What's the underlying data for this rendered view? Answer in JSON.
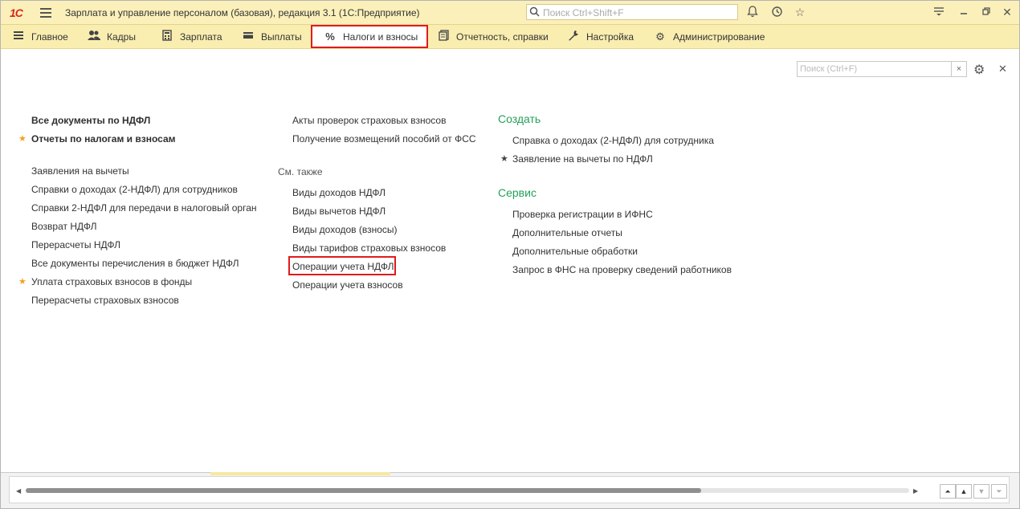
{
  "titlebar": {
    "logo": "1С",
    "title": "Зарплата и управление персоналом (базовая), редакция 3.1  (1С:Предприятие)",
    "search_placeholder": "Поиск Ctrl+Shift+F"
  },
  "menu": [
    {
      "label": "Главное",
      "icon": "menu-icon"
    },
    {
      "label": "Кадры",
      "icon": "people-icon"
    },
    {
      "label": "Зарплата",
      "icon": "calculator-icon"
    },
    {
      "label": "Выплаты",
      "icon": "wallet-icon"
    },
    {
      "label": "Налоги и взносы",
      "icon": "percent-icon",
      "glyph": "%",
      "active": true
    },
    {
      "label": "Отчетность, справки",
      "icon": "documents-icon"
    },
    {
      "label": "Настройка",
      "icon": "wrench-icon"
    },
    {
      "label": "Администрирование",
      "icon": "gear-icon"
    }
  ],
  "local_search": {
    "placeholder": "Поиск (Ctrl+F)",
    "clear": "×"
  },
  "column1": {
    "bold_links": [
      "Все документы по НДФЛ",
      "Отчеты по налогам и взносам"
    ],
    "links": [
      "Заявления на вычеты",
      "Справки о доходах (2-НДФЛ) для сотрудников",
      "Справки 2-НДФЛ для передачи в налоговый орган",
      "Возврат НДФЛ",
      "Перерасчеты НДФЛ",
      "Все документы перечисления в бюджет НДФЛ",
      "Уплата страховых взносов в фонды",
      "Перерасчеты страховых взносов"
    ]
  },
  "column2": {
    "links": [
      "Акты проверок страховых взносов",
      "Получение возмещений пособий от ФСС"
    ],
    "see_also_label": "См. также",
    "see_also": [
      "Виды доходов НДФЛ",
      "Виды вычетов НДФЛ",
      "Виды доходов (взносы)",
      "Виды тарифов страховых взносов",
      "Операции учета НДФЛ",
      "Операции учета взносов"
    ]
  },
  "column3": {
    "create_header": "Создать",
    "create_links": [
      "Справка о доходах (2-НДФЛ) для сотрудника",
      "Заявление на вычеты по НДФЛ"
    ],
    "service_header": "Сервис",
    "service_links": [
      "Проверка регистрации в ИФНС",
      "Дополнительные отчеты",
      "Дополнительные обработки",
      "Запрос в ФНС на проверку сведений работников"
    ]
  },
  "colors": {
    "accent_red": "#e11b1b",
    "section_green": "#25a05a",
    "star": "#f0a31a",
    "titlebar_bg": "#fbf0ba"
  },
  "scroll": {
    "position_fraction": 0.76
  }
}
